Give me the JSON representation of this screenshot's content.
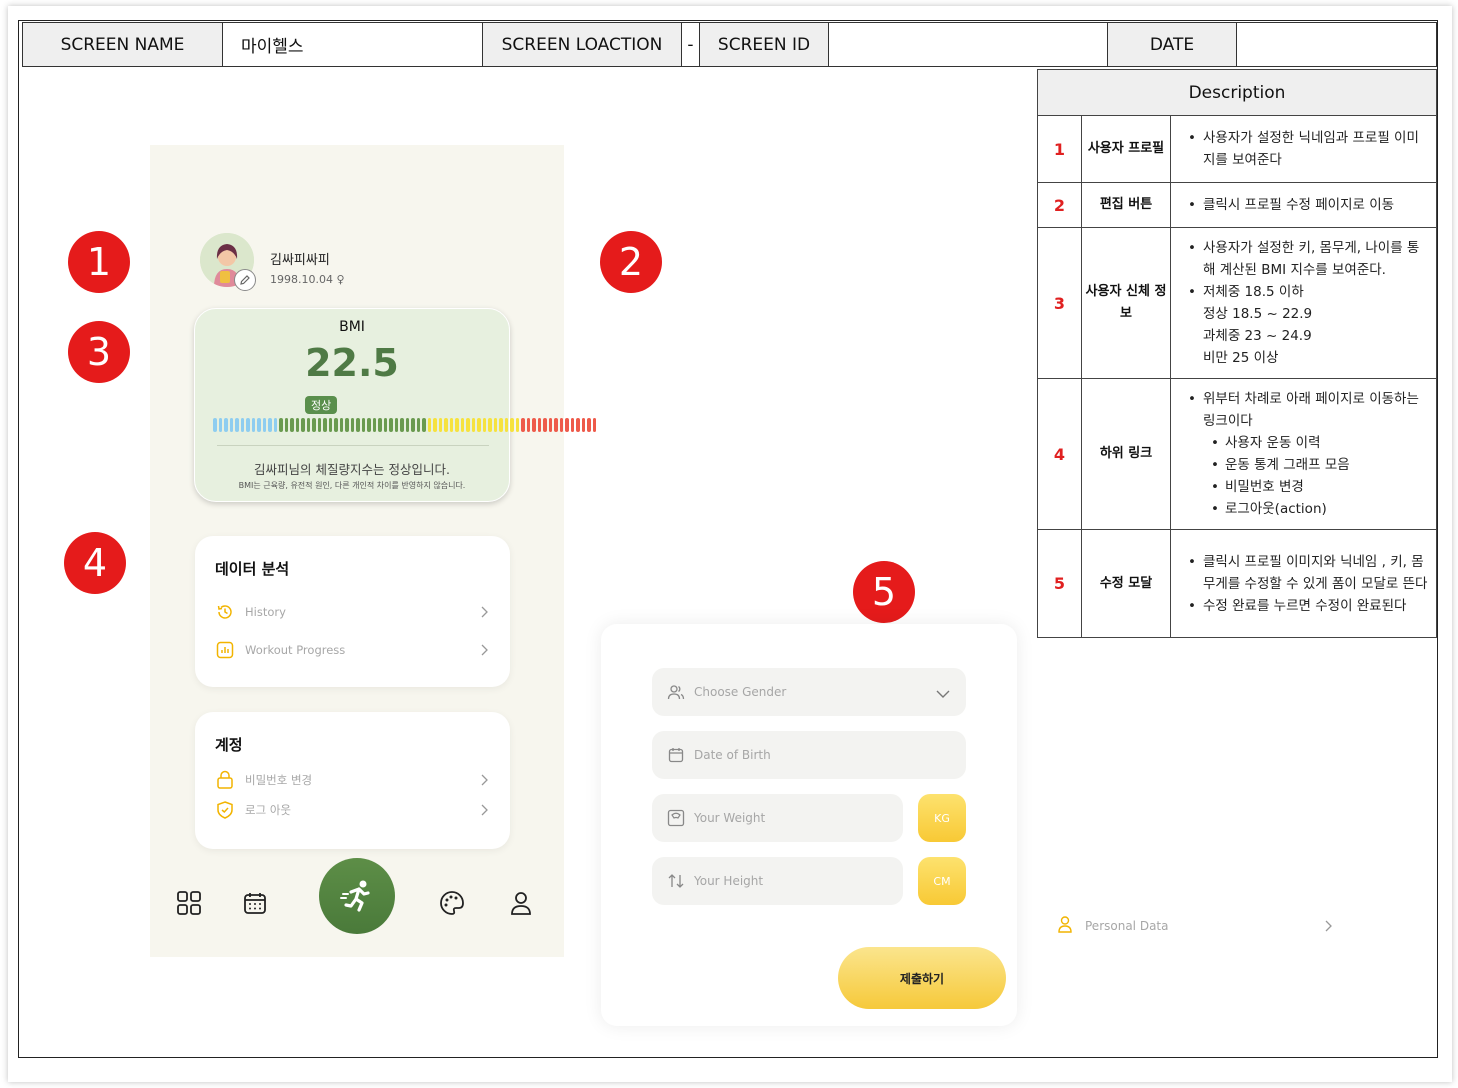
{
  "header": {
    "screen_name_label": "SCREEN NAME",
    "screen_name_value": "마이헬스",
    "screen_location_label": "SCREEN LOACTION",
    "screen_location_value": "-",
    "screen_id_label": "SCREEN ID",
    "screen_id_value": "",
    "date_label": "DATE",
    "date_value": ""
  },
  "description": {
    "title": "Description",
    "rows": [
      {
        "num": "1",
        "name": "사용자 프로필",
        "items": [
          "사용자가 설정한 닉네임과 프로필 이미지를 보여준다"
        ]
      },
      {
        "num": "2",
        "name": "편집 버튼",
        "items": [
          "클릭시 프로필 수정 페이지로 이동"
        ]
      },
      {
        "num": "3",
        "name": "사용자 신체 정보",
        "items": [
          "사용자가 설정한 키, 몸무게, 나이를 통해 계산된 BMI 지수를 보여준다.",
          "저체중 18.5 이하",
          "정상 18.5 ~ 22.9",
          "과체중 23 ~ 24.9",
          "비만 25 이상"
        ]
      },
      {
        "num": "4",
        "name": "하위 링크",
        "items": [
          "위부터 차례로 아래 페이지로 이동하는 링크이다",
          "사용자 운동 이력",
          "운동 통계  그래프 모음",
          "비밀번호 변경",
          "로그아웃(action)"
        ]
      },
      {
        "num": "5",
        "name": "수정 모달",
        "items": [
          "클릭시 프로필 이미지와 닉네임 , 키, 몸무게를 수정할 수 있게 폼이 모달로 뜬다",
          "수정 완료를 누르면 수정이 완료된다"
        ]
      }
    ]
  },
  "markers": [
    "1",
    "2",
    "3",
    "4",
    "5"
  ],
  "profile": {
    "nickname": "김싸피싸피",
    "birth": "1998.10.04"
  },
  "bmi": {
    "title": "BMI",
    "value": "22.5",
    "status": "정상",
    "message": "김싸피님의 체질량지수는 정상입니다.",
    "note": "BMI는 근육량, 유전적 원인, 다른 개인적 차이를 반영하지 않습니다.",
    "bar_colors": {
      "under": "#8ecdf0",
      "normal": "#6a9a4f",
      "over": "#f6e23d",
      "obese": "#ee5a4a"
    },
    "bar_counts": {
      "under": 12,
      "normal": 27,
      "over": 17,
      "obese": 14
    }
  },
  "analysis": {
    "title": "데이터 분석",
    "items": [
      {
        "label": "History",
        "icon": "history-icon"
      },
      {
        "label": "Workout Progress",
        "icon": "chart-icon"
      }
    ]
  },
  "account": {
    "title": "계정",
    "items": [
      {
        "label": "비밀번호 변경",
        "icon": "lock-icon"
      },
      {
        "label": "로그 아웃",
        "icon": "shield-icon"
      }
    ]
  },
  "modal": {
    "gender_placeholder": "Choose Gender",
    "birth_placeholder": "Date of Birth",
    "weight_placeholder": "Your Weight",
    "weight_unit": "KG",
    "height_placeholder": "Your Height",
    "height_unit": "CM",
    "submit_label": "제출하기"
  },
  "personal_data": {
    "label": "Personal Data"
  },
  "colors": {
    "accent_green": "#5a8f4c",
    "accent_yellow": "#f8c935",
    "marker_red": "#e51b1b"
  }
}
